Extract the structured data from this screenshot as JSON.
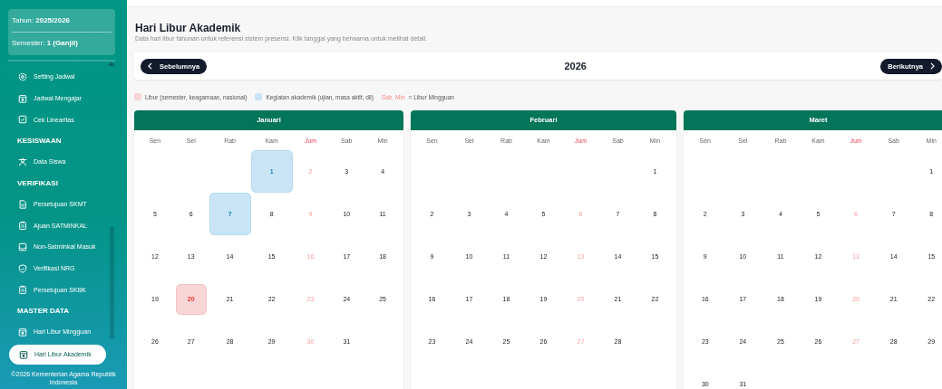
{
  "sidebar": {
    "year_label": "Tahun:",
    "year": "2025/2026",
    "semester_label": "Semester:",
    "semester": "1 (Ganjil)",
    "items": [
      {
        "kind": "link",
        "label": "Setting Jadwal",
        "selected": false
      },
      {
        "kind": "link",
        "label": "Jadwal Mengajar",
        "selected": false
      },
      {
        "kind": "link",
        "label": "Cek Linearitas",
        "selected": false
      },
      {
        "kind": "heading",
        "label": "KESISWAAN"
      },
      {
        "kind": "link",
        "label": "Data Siswa",
        "selected": false
      },
      {
        "kind": "heading",
        "label": "VERIFIKASI"
      },
      {
        "kind": "link",
        "label": "Persetujuan SKMT",
        "selected": false
      },
      {
        "kind": "link",
        "label": "Ajuan SATMINKAL",
        "selected": false
      },
      {
        "kind": "link",
        "label": "Non-Satminkal Masuk",
        "selected": false
      },
      {
        "kind": "link",
        "label": "Verifikasi NRG",
        "selected": false
      },
      {
        "kind": "link",
        "label": "Persetujuan SKBK",
        "selected": false
      },
      {
        "kind": "heading",
        "label": "MASTER DATA"
      },
      {
        "kind": "link",
        "label": "Hari Libur Mingguan",
        "selected": false
      },
      {
        "kind": "link",
        "label": "Hari Libur Akademik",
        "selected": true
      }
    ],
    "footer": "©2026 Kementerian Agama Republik Indonesia"
  },
  "page": {
    "title": "Hari Libur Akademik",
    "subtitle": "Data hari libur tahunan untuk referensi sistem presensi. Klik tanggal yang berwarna untuk melihat detail."
  },
  "nav": {
    "prev": "Sebelumnya",
    "year": "2026",
    "next": "Berikutnya"
  },
  "legend": {
    "holiday": "Libur (semester, keagamaan, nasional)",
    "academic": "Kegiatan akademik (ujian, masa aktif, dll)",
    "weekend_days": "Sab, Min",
    "weekend_text": "= Libur Mingguan"
  },
  "months": [
    {
      "name": "Januari",
      "weekdays": [
        {
          "label": "Sen",
          "weekend": false
        },
        {
          "label": "Sel",
          "weekend": false
        },
        {
          "label": "Rab",
          "weekend": false
        },
        {
          "label": "Kam",
          "weekend": false
        },
        {
          "label": "Jum",
          "weekend": true
        },
        {
          "label": "Sab",
          "weekend": false
        },
        {
          "label": "Min",
          "weekend": false
        }
      ],
      "weeks": [
        [
          {
            "day": "1",
            "kind": "academic"
          },
          "2",
          "3",
          "4"
        ],
        [
          "5",
          "6",
          {
            "day": "7",
            "kind": "academic"
          },
          "8",
          "9",
          "10",
          "11"
        ],
        [
          "12",
          "13",
          "14",
          "15",
          "16",
          "17",
          "18"
        ],
        [
          "19",
          {
            "day": "20",
            "kind": "holiday"
          },
          "21",
          "22",
          "23",
          "24",
          "25"
        ],
        [
          "26",
          "27",
          "28",
          "29",
          "30",
          "31"
        ]
      ]
    },
    {
      "name": "Februari",
      "weekdays": [
        {
          "label": "Sen",
          "weekend": false
        },
        {
          "label": "Sel",
          "weekend": false
        },
        {
          "label": "Rab",
          "weekend": false
        },
        {
          "label": "Kam",
          "weekend": false
        },
        {
          "label": "Jum",
          "weekend": true
        },
        {
          "label": "Sab",
          "weekend": false
        },
        {
          "label": "Min",
          "weekend": false
        }
      ],
      "weeks": [
        [
          "1"
        ],
        [
          "2",
          "3",
          "4",
          "5",
          "6",
          "7",
          "8"
        ],
        [
          "9",
          "10",
          "11",
          "12",
          "13",
          "14",
          "15"
        ],
        [
          "16",
          "17",
          "18",
          "19",
          "20",
          "21",
          "22"
        ],
        [
          "23",
          "24",
          "25",
          "26",
          "27",
          "28"
        ]
      ]
    },
    {
      "name": "Maret",
      "weekdays": [
        {
          "label": "Sen",
          "weekend": false
        },
        {
          "label": "Sel",
          "weekend": false
        },
        {
          "label": "Rab",
          "weekend": false
        },
        {
          "label": "Kam",
          "weekend": false
        },
        {
          "label": "Jum",
          "weekend": true
        },
        {
          "label": "Sab",
          "weekend": false
        },
        {
          "label": "Min",
          "weekend": false
        }
      ],
      "weeks": [
        [
          "1"
        ],
        [
          "2",
          "3",
          "4",
          "5",
          "6",
          "7",
          "8"
        ],
        [
          "9",
          "10",
          "11",
          "12",
          "13",
          "14",
          "15"
        ],
        [
          "16",
          "17",
          "18",
          "19",
          "20",
          "21",
          "22"
        ],
        [
          "23",
          "24",
          "25",
          "26",
          "27",
          "28",
          "29"
        ],
        [
          "30",
          "31"
        ]
      ]
    }
  ]
}
